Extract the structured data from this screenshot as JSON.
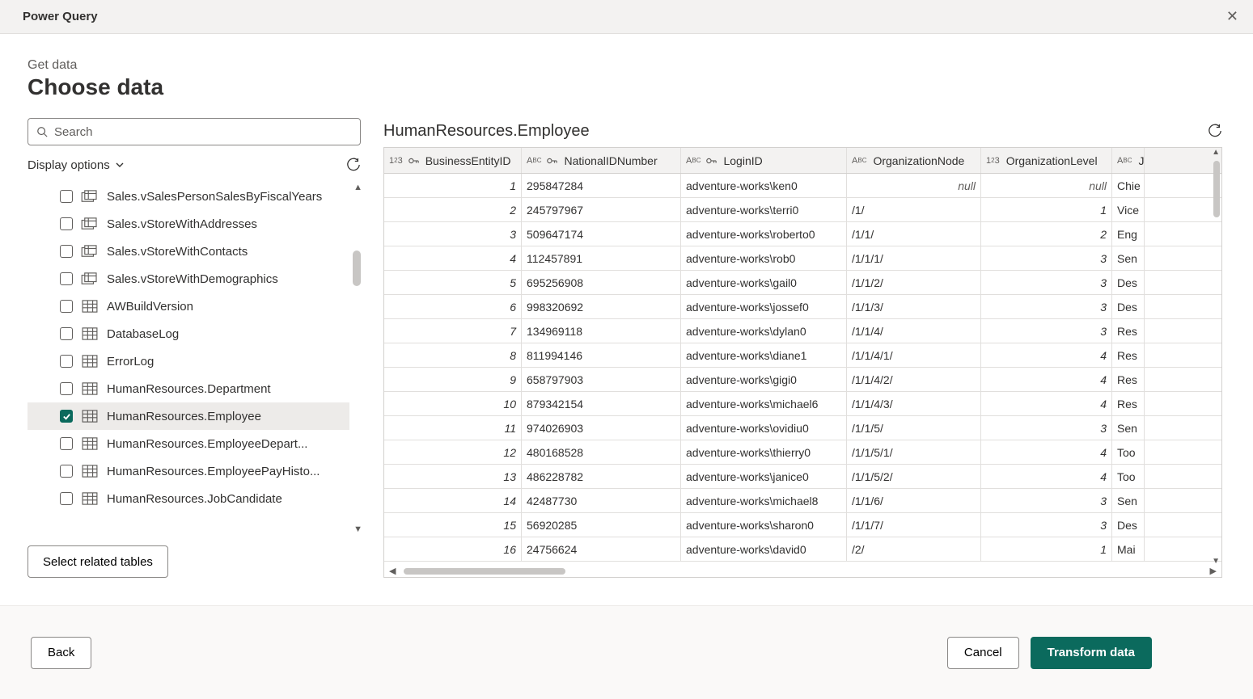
{
  "window": {
    "title": "Power Query"
  },
  "header": {
    "subtitle": "Get data",
    "title": "Choose data"
  },
  "search": {
    "placeholder": "Search"
  },
  "display_options_label": "Display options",
  "related_tables_label": "Select related tables",
  "sidebar": {
    "items": [
      {
        "label": "Sales.vSalesPersonSalesByFiscalYears",
        "kind": "view",
        "checked": false
      },
      {
        "label": "Sales.vStoreWithAddresses",
        "kind": "view",
        "checked": false
      },
      {
        "label": "Sales.vStoreWithContacts",
        "kind": "view",
        "checked": false
      },
      {
        "label": "Sales.vStoreWithDemographics",
        "kind": "view",
        "checked": false
      },
      {
        "label": "AWBuildVersion",
        "kind": "table",
        "checked": false
      },
      {
        "label": "DatabaseLog",
        "kind": "table",
        "checked": false
      },
      {
        "label": "ErrorLog",
        "kind": "table",
        "checked": false
      },
      {
        "label": "HumanResources.Department",
        "kind": "table",
        "checked": false
      },
      {
        "label": "HumanResources.Employee",
        "kind": "table",
        "checked": true
      },
      {
        "label": "HumanResources.EmployeeDepart...",
        "kind": "table",
        "checked": false
      },
      {
        "label": "HumanResources.EmployeePayHisto...",
        "kind": "table",
        "checked": false
      },
      {
        "label": "HumanResources.JobCandidate",
        "kind": "table",
        "checked": false
      }
    ]
  },
  "preview": {
    "title": "HumanResources.Employee",
    "columns": [
      {
        "name": "BusinessEntityID",
        "type": "number",
        "key": true
      },
      {
        "name": "NationalIDNumber",
        "type": "text",
        "key": true
      },
      {
        "name": "LoginID",
        "type": "text",
        "key": true
      },
      {
        "name": "OrganizationNode",
        "type": "text",
        "key": false
      },
      {
        "name": "OrganizationLevel",
        "type": "number",
        "key": false
      },
      {
        "name": "JobTitle",
        "type": "text",
        "key": false
      }
    ],
    "rows": [
      {
        "BusinessEntityID": "1",
        "NationalIDNumber": "295847284",
        "LoginID": "adventure-works\\ken0",
        "OrganizationNode": null,
        "OrganizationLevel": null,
        "JobTitle": "Chie"
      },
      {
        "BusinessEntityID": "2",
        "NationalIDNumber": "245797967",
        "LoginID": "adventure-works\\terri0",
        "OrganizationNode": "/1/",
        "OrganizationLevel": "1",
        "JobTitle": "Vice"
      },
      {
        "BusinessEntityID": "3",
        "NationalIDNumber": "509647174",
        "LoginID": "adventure-works\\roberto0",
        "OrganizationNode": "/1/1/",
        "OrganizationLevel": "2",
        "JobTitle": "Eng"
      },
      {
        "BusinessEntityID": "4",
        "NationalIDNumber": "112457891",
        "LoginID": "adventure-works\\rob0",
        "OrganizationNode": "/1/1/1/",
        "OrganizationLevel": "3",
        "JobTitle": "Sen"
      },
      {
        "BusinessEntityID": "5",
        "NationalIDNumber": "695256908",
        "LoginID": "adventure-works\\gail0",
        "OrganizationNode": "/1/1/2/",
        "OrganizationLevel": "3",
        "JobTitle": "Des"
      },
      {
        "BusinessEntityID": "6",
        "NationalIDNumber": "998320692",
        "LoginID": "adventure-works\\jossef0",
        "OrganizationNode": "/1/1/3/",
        "OrganizationLevel": "3",
        "JobTitle": "Des"
      },
      {
        "BusinessEntityID": "7",
        "NationalIDNumber": "134969118",
        "LoginID": "adventure-works\\dylan0",
        "OrganizationNode": "/1/1/4/",
        "OrganizationLevel": "3",
        "JobTitle": "Res"
      },
      {
        "BusinessEntityID": "8",
        "NationalIDNumber": "811994146",
        "LoginID": "adventure-works\\diane1",
        "OrganizationNode": "/1/1/4/1/",
        "OrganizationLevel": "4",
        "JobTitle": "Res"
      },
      {
        "BusinessEntityID": "9",
        "NationalIDNumber": "658797903",
        "LoginID": "adventure-works\\gigi0",
        "OrganizationNode": "/1/1/4/2/",
        "OrganizationLevel": "4",
        "JobTitle": "Res"
      },
      {
        "BusinessEntityID": "10",
        "NationalIDNumber": "879342154",
        "LoginID": "adventure-works\\michael6",
        "OrganizationNode": "/1/1/4/3/",
        "OrganizationLevel": "4",
        "JobTitle": "Res"
      },
      {
        "BusinessEntityID": "11",
        "NationalIDNumber": "974026903",
        "LoginID": "adventure-works\\ovidiu0",
        "OrganizationNode": "/1/1/5/",
        "OrganizationLevel": "3",
        "JobTitle": "Sen"
      },
      {
        "BusinessEntityID": "12",
        "NationalIDNumber": "480168528",
        "LoginID": "adventure-works\\thierry0",
        "OrganizationNode": "/1/1/5/1/",
        "OrganizationLevel": "4",
        "JobTitle": "Too"
      },
      {
        "BusinessEntityID": "13",
        "NationalIDNumber": "486228782",
        "LoginID": "adventure-works\\janice0",
        "OrganizationNode": "/1/1/5/2/",
        "OrganizationLevel": "4",
        "JobTitle": "Too"
      },
      {
        "BusinessEntityID": "14",
        "NationalIDNumber": "42487730",
        "LoginID": "adventure-works\\michael8",
        "OrganizationNode": "/1/1/6/",
        "OrganizationLevel": "3",
        "JobTitle": "Sen"
      },
      {
        "BusinessEntityID": "15",
        "NationalIDNumber": "56920285",
        "LoginID": "adventure-works\\sharon0",
        "OrganizationNode": "/1/1/7/",
        "OrganizationLevel": "3",
        "JobTitle": "Des"
      },
      {
        "BusinessEntityID": "16",
        "NationalIDNumber": "24756624",
        "LoginID": "adventure-works\\david0",
        "OrganizationNode": "/2/",
        "OrganizationLevel": "1",
        "JobTitle": "Mai"
      }
    ]
  },
  "footer": {
    "back_label": "Back",
    "cancel_label": "Cancel",
    "transform_label": "Transform data"
  },
  "null_text": "null"
}
